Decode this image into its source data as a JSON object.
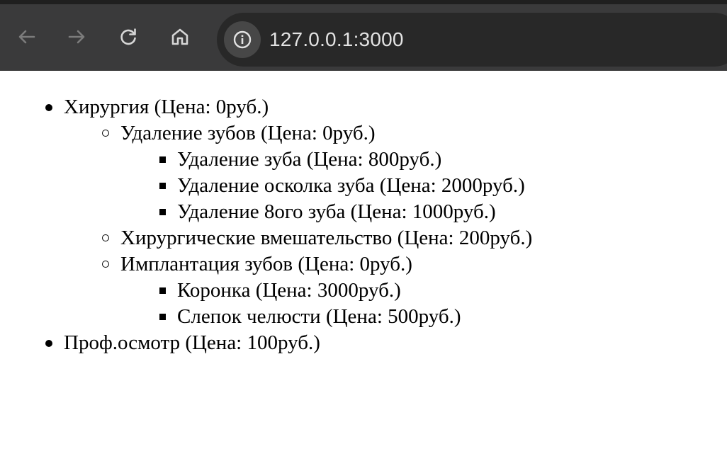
{
  "browser": {
    "url": "127.0.0.1:3000",
    "icons": {
      "back": "arrow-left-icon",
      "forward": "arrow-right-icon",
      "reload": "reload-icon",
      "home": "home-icon",
      "site_info": "info-icon"
    }
  },
  "services": {
    "surgery": {
      "label": "Хирургия (Цена: 0руб.)",
      "tooth_removal": {
        "label": "Удаление зубов (Цена: 0руб.)",
        "items": [
          "Удаление зуба (Цена: 800руб.)",
          "Удаление осколка зуба (Цена: 2000руб.)",
          "Удаление 8ого зуба (Цена: 1000руб.)"
        ]
      },
      "interventions": {
        "label": "Хирургические вмешательство (Цена: 200руб.)"
      },
      "implantation": {
        "label": "Имплантация зубов (Цена: 0руб.)",
        "items": [
          "Коронка (Цена: 3000руб.)",
          "Слепок челюсти (Цена: 500руб.)"
        ]
      }
    },
    "checkup": {
      "label": "Проф.осмотр (Цена: 100руб.)"
    }
  }
}
